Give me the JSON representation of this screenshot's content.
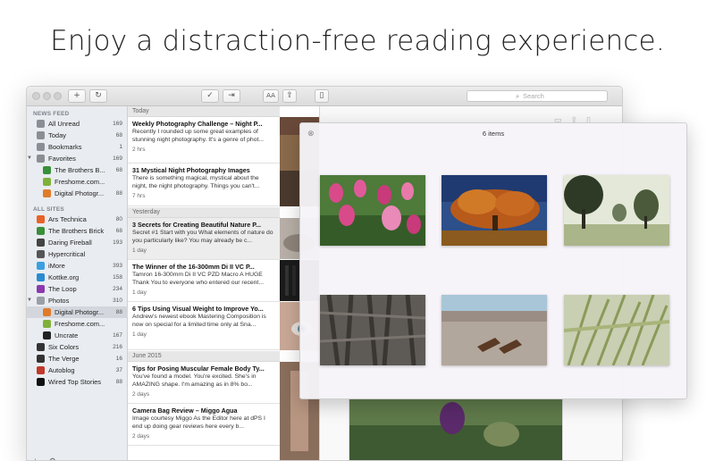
{
  "headline": "Enjoy a distraction-free reading experience.",
  "toolbar": {
    "add_label": "+",
    "refresh_label": "↻",
    "mark_read_label": "✓",
    "next_label": "⇥",
    "font_label": "AA",
    "share_label": "⇪",
    "bookmark_label": "▯",
    "search_placeholder": "Search"
  },
  "sidebar": {
    "news_feed_header": "NEWS FEED",
    "feed_items": [
      {
        "label": "All Unread",
        "count": "169",
        "icon": "inbox-icon",
        "color": "#8a8f96"
      },
      {
        "label": "Today",
        "count": "68",
        "icon": "calendar-icon",
        "color": "#8a8f96"
      },
      {
        "label": "Bookmarks",
        "count": "1",
        "icon": "bookmark-icon",
        "color": "#8a8f96"
      },
      {
        "label": "Favorites",
        "count": "169",
        "icon": "star-icon",
        "color": "#8a8f96"
      },
      {
        "label": "The Brothers B...",
        "count": "68",
        "icon": "brothers-brick-icon",
        "color": "#3a8f3a"
      },
      {
        "label": "Freshome.com...",
        "count": "",
        "icon": "freshome-icon",
        "color": "#7fb13a"
      },
      {
        "label": "Digital Photogr...",
        "count": "88",
        "icon": "dps-icon",
        "color": "#e07b2a"
      }
    ],
    "all_sites_header": "ALL SITES",
    "site_items": [
      {
        "label": "Ars Technica",
        "count": "80",
        "icon": "ars-technica-icon",
        "color": "#e8622a"
      },
      {
        "label": "The Brothers Brick",
        "count": "68",
        "icon": "brothers-brick-icon",
        "color": "#3a8f3a"
      },
      {
        "label": "Daring Fireball",
        "count": "193",
        "icon": "daring-fireball-icon",
        "color": "#444444"
      },
      {
        "label": "Hypercritical",
        "count": "",
        "icon": "hypercritical-icon",
        "color": "#555555"
      },
      {
        "label": "iMore",
        "count": "393",
        "icon": "imore-icon",
        "color": "#3aa0e0"
      },
      {
        "label": "Kottke.org",
        "count": "158",
        "icon": "kottke-icon",
        "color": "#2a8ad0"
      },
      {
        "label": "The Loop",
        "count": "234",
        "icon": "the-loop-icon",
        "color": "#8a3ab0"
      },
      {
        "label": "Photos",
        "count": "310",
        "icon": "folder-icon",
        "color": "#9aa0a8"
      },
      {
        "label": "Digital Photogr...",
        "count": "88",
        "icon": "dps-icon",
        "color": "#e07b2a"
      },
      {
        "label": "Freshome.com...",
        "count": "",
        "icon": "freshome-icon",
        "color": "#7fb13a"
      },
      {
        "label": "Uncrate",
        "count": "167",
        "icon": "uncrate-icon",
        "color": "#222222"
      },
      {
        "label": "Six Colors",
        "count": "216",
        "icon": "six-colors-icon",
        "color": "#333333"
      },
      {
        "label": "The Verge",
        "count": "16",
        "icon": "the-verge-icon",
        "color": "#333333"
      },
      {
        "label": "Autoblog",
        "count": "37",
        "icon": "autoblog-icon",
        "color": "#c0392b"
      },
      {
        "label": "Wired Top Stories",
        "count": "88",
        "icon": "wired-icon",
        "color": "#111111"
      }
    ],
    "add_label": "+",
    "settings_label": "⚙"
  },
  "articles": {
    "groups": [
      "Today",
      "Yesterday",
      "June 2015"
    ],
    "items": [
      {
        "title": "Weekly Photography Challenge – Night P...",
        "body": "Recently I rounded up some great examples of stunning night photography. It's a genre of phot...",
        "time": "2 hrs"
      },
      {
        "title": "31 Mystical Night Photography Images",
        "body": "There is something magical, mystical about the night, the night photography. Things you can't...",
        "time": "7 hrs"
      },
      {
        "title": "3 Secrets for Creating Beautiful Nature P...",
        "body": "Secret #1 Start with you What elements of nature do you particularly like? You may already be c...",
        "time": "1 day"
      },
      {
        "title": "The Winner of the 16-300mm Di II VC P...",
        "body": "Tamron 16-300mm Di II VC PZD Macro A HUGE Thank You to everyone who entered our recent...",
        "time": "1 day"
      },
      {
        "title": "6 Tips Using Visual Weight to Improve Yo...",
        "body": "Andrew's newest ebook Mastering Composition is now on special for a limited time only at Sna...",
        "time": "1 day"
      },
      {
        "title": "Tips for Posing Muscular Female Body Ty...",
        "body": "You've found a model. You're excited. She's in AMAZING shape. I'm amazing as in 8% bo...",
        "time": "2 days"
      },
      {
        "title": "Camera Bag Review – Miggo Agua",
        "body": "Image courtesy Miggo As the Editor here at dPS I end up doing gear reviews here every b...",
        "time": "2 days"
      }
    ]
  },
  "popover": {
    "title": "6 items",
    "close_label": "⊗",
    "photos": [
      "tulips-photo",
      "autumn-tree-photo",
      "park-trees-photo",
      "tree-bark-photo",
      "beach-feet-photo",
      "wheat-field-photo"
    ]
  },
  "colors": {
    "sidebar_bg": "#e9ecf0",
    "selection": "#d3d7dd",
    "popover_bg": "#f6f4f8"
  }
}
